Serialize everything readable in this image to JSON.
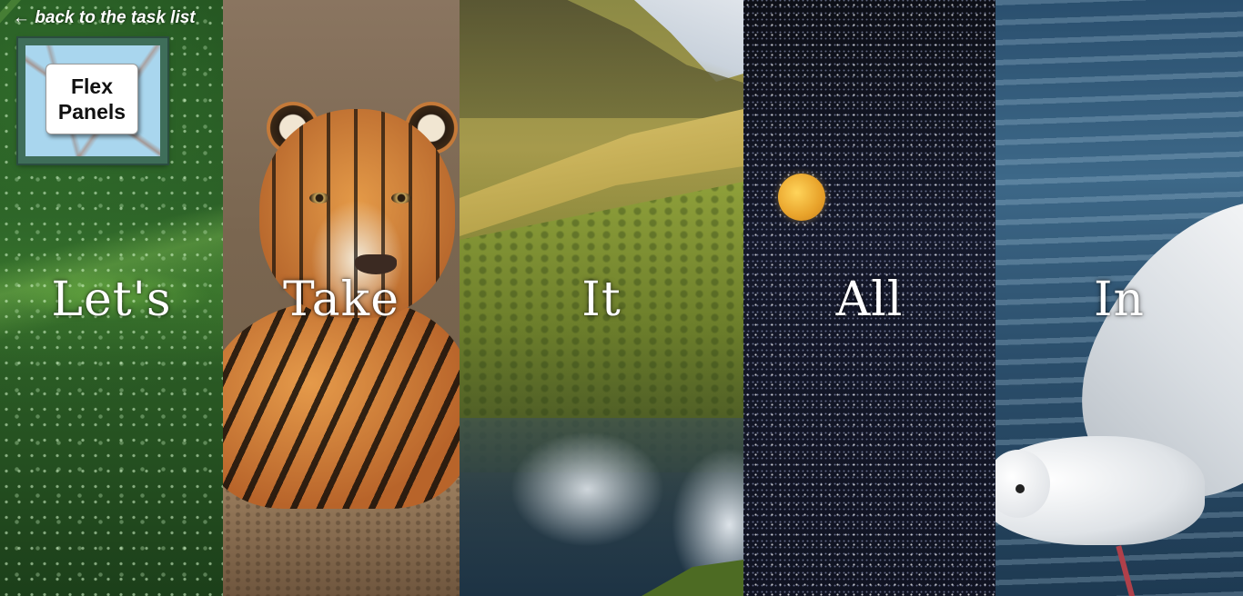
{
  "nav": {
    "back_link_text": "← back to the task list"
  },
  "title_card": {
    "line1": "Flex",
    "line2": "Panels"
  },
  "panels": [
    {
      "word": "Let's",
      "image": "leaf-with-water-drops"
    },
    {
      "word": "Take",
      "image": "tiger"
    },
    {
      "word": "It",
      "image": "mountain-waterfall"
    },
    {
      "word": "All",
      "image": "night-sky-moon"
    },
    {
      "word": "In",
      "image": "seagull-over-water"
    }
  ],
  "colors": {
    "frame_border": "#3f6e5a",
    "word_text": "#ffffff"
  }
}
